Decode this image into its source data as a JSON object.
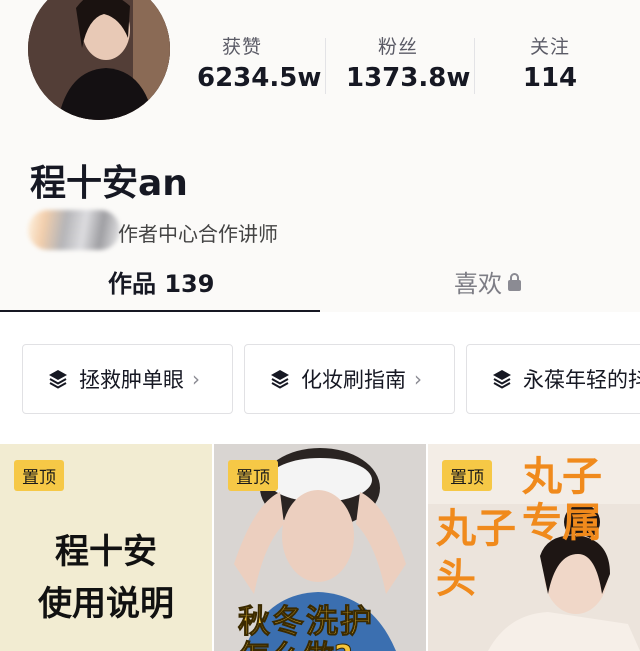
{
  "profile": {
    "name": "程十安an",
    "certification": "作者中心合作讲师"
  },
  "stats": [
    {
      "label": "获赞",
      "value": "6234.5w"
    },
    {
      "label": "粉丝",
      "value": "1373.8w"
    },
    {
      "label": "关注",
      "value": "114"
    }
  ],
  "tabs": {
    "works": "作品 139",
    "likes": "喜欢"
  },
  "collections": [
    {
      "label": "拯救肿单眼",
      "icon": "layers-icon"
    },
    {
      "label": "化妆刷指南",
      "icon": "layers-icon"
    },
    {
      "label": "永葆年轻的抖",
      "icon": "layers-icon"
    }
  ],
  "videos": [
    {
      "pin": "置顶",
      "title_line1": "程十安",
      "title_line2": "使用说明"
    },
    {
      "pin": "置顶",
      "caption_line1": "秋冬洗护",
      "caption_line2": "怎么做?"
    },
    {
      "pin": "置顶",
      "caption_line1": "丸子专属",
      "caption_line2": "丸子",
      "caption_line3": "头"
    }
  ],
  "colors": {
    "pin_bg": "#f6c846",
    "accent_text": "#161823",
    "caption_orange": "#f08a1c",
    "caption_yellow": "#f5c53a"
  }
}
